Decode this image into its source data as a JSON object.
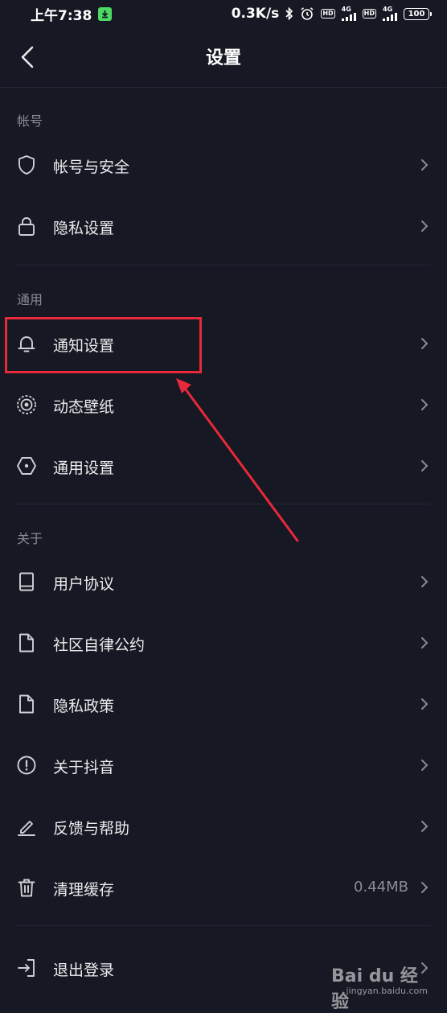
{
  "status_bar": {
    "time": "上午7:38",
    "network_speed": "0.3K/s",
    "hd_label": "HD",
    "net_4g": "4G",
    "battery": "100"
  },
  "header": {
    "title": "设置"
  },
  "sections": [
    {
      "title": "帐号",
      "items": [
        {
          "label": "帐号与安全",
          "icon": "shield-icon"
        },
        {
          "label": "隐私设置",
          "icon": "lock-icon"
        }
      ]
    },
    {
      "title": "通用",
      "items": [
        {
          "label": "通知设置",
          "icon": "bell-icon"
        },
        {
          "label": "动态壁纸",
          "icon": "target-icon"
        },
        {
          "label": "通用设置",
          "icon": "hexagon-icon"
        }
      ]
    },
    {
      "title": "关于",
      "items": [
        {
          "label": "用户协议",
          "icon": "book-icon"
        },
        {
          "label": "社区自律公约",
          "icon": "document-icon"
        },
        {
          "label": "隐私政策",
          "icon": "document-icon"
        },
        {
          "label": "关于抖音",
          "icon": "info-icon"
        },
        {
          "label": "反馈与帮助",
          "icon": "edit-icon"
        },
        {
          "label": "清理缓存",
          "icon": "trash-icon",
          "value": "0.44MB"
        }
      ]
    },
    {
      "title": "",
      "items": [
        {
          "label": "退出登录",
          "icon": "logout-icon"
        }
      ]
    }
  ],
  "watermark": {
    "logo": "Bai du 经验",
    "url": "jingyan.baidu.com"
  },
  "colors": {
    "background": "#161823",
    "highlight": "#e8293a",
    "muted": "#8a8b93"
  }
}
